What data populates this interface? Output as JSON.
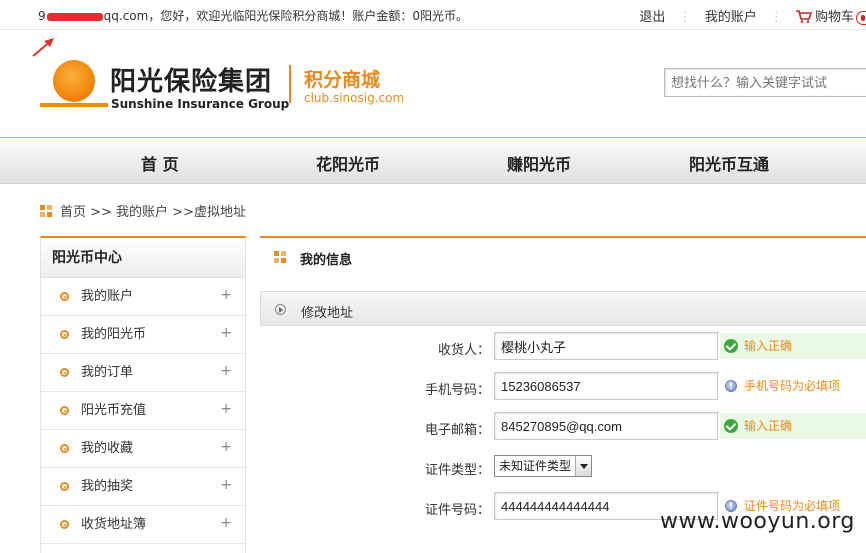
{
  "topbar": {
    "user_prefix": "9",
    "user_suffix": "qq.com，您好，欢迎光临阳光保险积分商城！账户金额：0阳光币。",
    "logout": "退出",
    "account": "我的账户",
    "cart": "购物车"
  },
  "header": {
    "logo_cn": "阳光保险集团",
    "logo_en": "Sunshine Insurance Group",
    "mall_title": "积分商城",
    "mall_url": "club.sinosig.com",
    "search_placeholder": "想找什么？输入关键字试试"
  },
  "nav": [
    {
      "label": "首 页"
    },
    {
      "label": "花阳光币"
    },
    {
      "label": "赚阳光币"
    },
    {
      "label": "阳光币互通"
    }
  ],
  "breadcrumb": {
    "text": "首页 >> 我的账户 >>虚拟地址"
  },
  "sidebar": {
    "title": "阳光币中心",
    "items": [
      {
        "label": "我的账户"
      },
      {
        "label": "我的阳光币"
      },
      {
        "label": "我的订单"
      },
      {
        "label": "阳光币充值"
      },
      {
        "label": "我的收藏"
      },
      {
        "label": "我的抽奖"
      },
      {
        "label": "收货地址簿"
      }
    ],
    "plus": "+"
  },
  "main": {
    "title": "我的信息",
    "section": "修改地址",
    "form": {
      "receiver": {
        "label": "收货人：",
        "value": "樱桃小丸子",
        "tip": "输入正确"
      },
      "phone": {
        "label": "手机号码：",
        "value": "15236086537",
        "tip": "手机号码为必填项"
      },
      "email": {
        "label": "电子邮箱：",
        "value": "845270895@qq.com",
        "tip": "输入正确"
      },
      "id_type": {
        "label": "证件类型：",
        "value": "未知证件类型"
      },
      "id_number": {
        "label": "证件号码：",
        "value": "444444444444444",
        "tip": "证件号码为必填项"
      }
    }
  },
  "watermark": "www.wooyun.org",
  "colors": {
    "accent": "#e8891a",
    "ok_green": "#3aa83a",
    "redaction": "#e0312c"
  }
}
